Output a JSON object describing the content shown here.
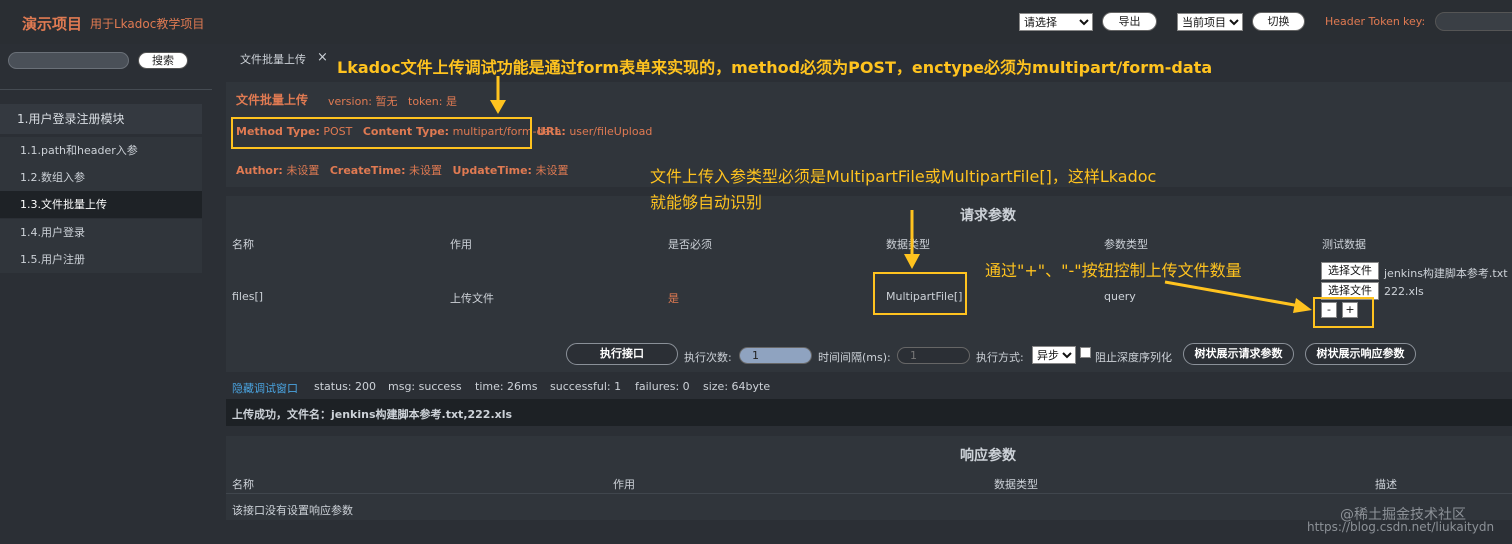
{
  "header": {
    "project_name": "演示项目",
    "project_desc": "用于Lkadoc教学项目",
    "select_placeholder": "请选择",
    "export_label": "导出",
    "current_project": "当前项目",
    "switch_label": "切换",
    "header_token_label": "Header Token",
    "key_label": "key:"
  },
  "sidebar": {
    "search_label": "搜索",
    "module_title": "1.用户登录注册模块",
    "items": [
      {
        "label": "1.1.path和header入参"
      },
      {
        "label": "1.2.数组入参"
      },
      {
        "label": "1.3.文件批量上传"
      },
      {
        "label": "1.4.用户登录"
      },
      {
        "label": "1.5.用户注册"
      }
    ]
  },
  "tab": {
    "label": "文件批量上传",
    "close": "×"
  },
  "api_info": {
    "title": "文件批量上传",
    "version_label": "version:",
    "version_value": "暂无",
    "token_label": "token:",
    "token_value": "是",
    "method_label": "Method Type:",
    "method_value": "POST",
    "content_label": "Content Type:",
    "content_value": "multipart/form-data",
    "url_label": "URL:",
    "url_value": "user/fileUpload",
    "author_label": "Author:",
    "author_value": "未设置",
    "create_label": "CreateTime:",
    "create_value": "未设置",
    "update_label": "UpdateTime:",
    "update_value": "未设置"
  },
  "request": {
    "title": "请求参数",
    "columns": [
      "名称",
      "作用",
      "是否必须",
      "数据类型",
      "参数类型",
      "测试数据"
    ],
    "row": {
      "name": "files[]",
      "purpose": "上传文件",
      "required": "是",
      "data_type": "MultipartFile[]",
      "param_type": "query"
    },
    "file_button_label": "选择文件",
    "file1": "jenkins构建脚本参考.txt",
    "file2": "222.xls",
    "minus": "-",
    "plus": "+"
  },
  "exec": {
    "exec_button": "执行接口",
    "count_label": "执行次数:",
    "count_value": "1",
    "interval_label": "时间间隔(ms):",
    "interval_value": "1",
    "mode_label": "执行方式:",
    "mode_value": "异步",
    "block_label": "阻止深度序列化",
    "tree_req": "树状展示请求参数",
    "tree_resp": "树状展示响应参数"
  },
  "status": {
    "hide_link": "隐藏调试窗口",
    "status": "status: 200",
    "msg": "msg: success",
    "time": "time: 26ms",
    "successful": "successful: 1",
    "failures": "failures: 0",
    "size": "size: 64byte",
    "result": "上传成功，文件名：jenkins构建脚本参考.txt,222.xls"
  },
  "response": {
    "title": "响应参数",
    "columns": [
      "名称",
      "作用",
      "数据类型",
      "描述"
    ],
    "empty": "该接口没有设置响应参数"
  },
  "annotations": {
    "a1": "Lkadoc文件上传调试功能是通过form表单来实现的，method必须为POST，enctype必须为multipart/form-data",
    "a2_line1": "文件上传入参类型必须是MultipartFile或MultipartFile[]，这样Lkadoc",
    "a2_line2": "就能够自动识别",
    "a3": "通过\"+\"、\"-\"按钮控制上传文件数量"
  },
  "watermark": {
    "line1": "@稀土掘金技术社区",
    "line2": "https://blog.csdn.net/liukaitydn"
  },
  "colors": {
    "accent": "#e07a52",
    "annotation": "#ffc31f"
  }
}
